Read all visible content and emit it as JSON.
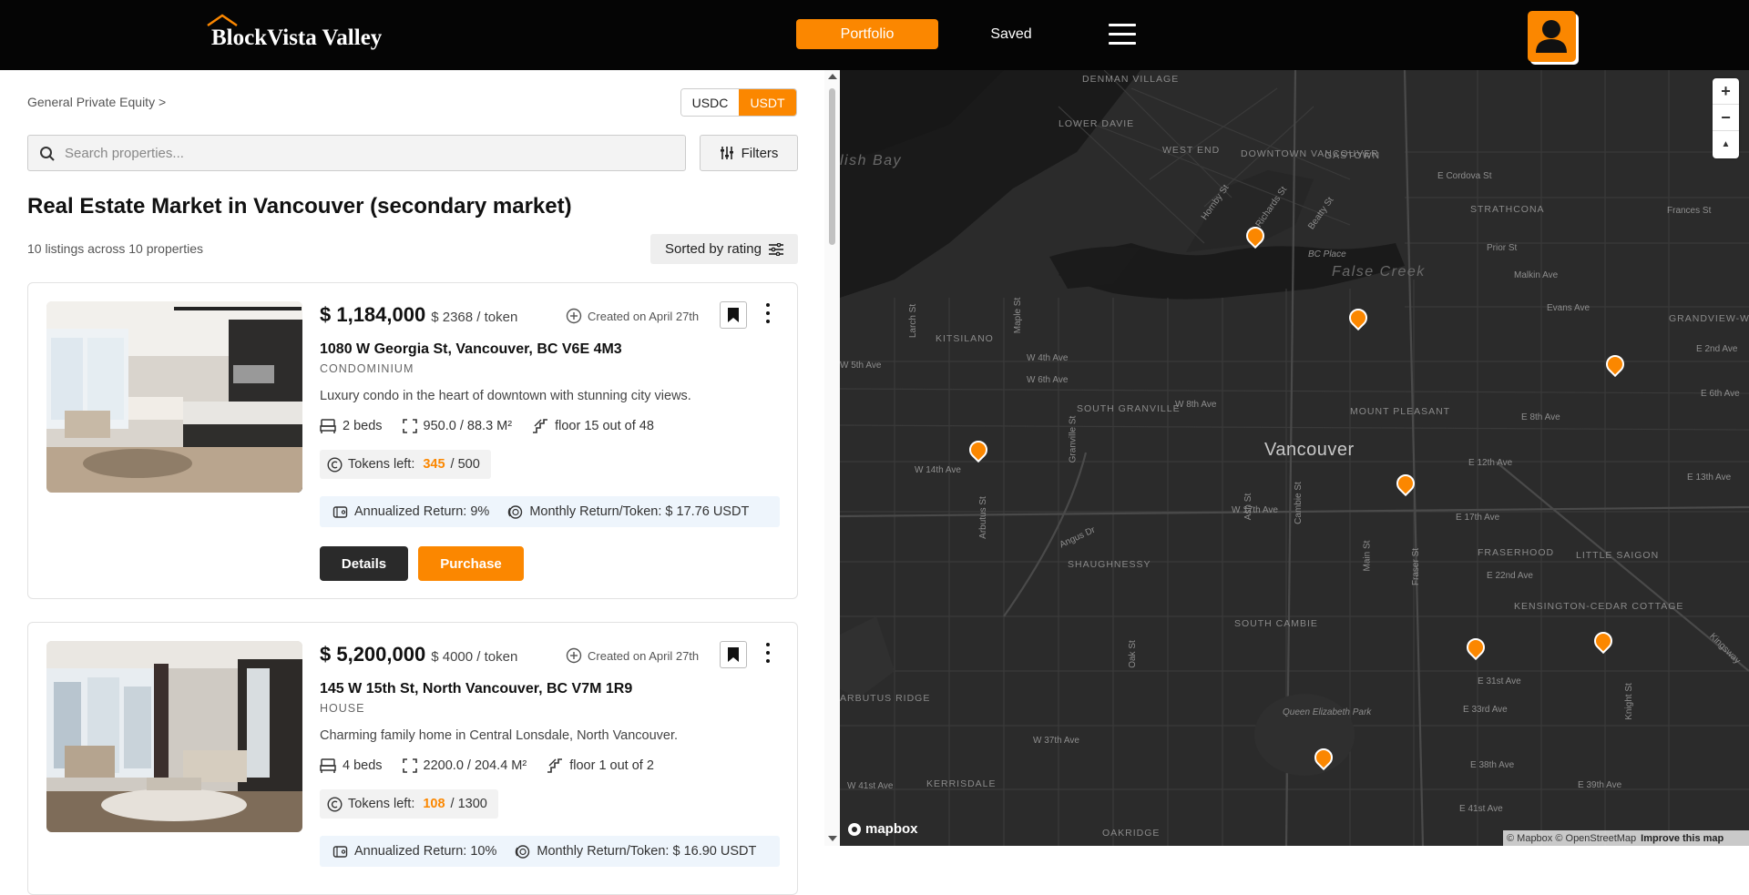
{
  "app": {
    "brand": "BlockVista Valley"
  },
  "nav": {
    "portfolio": "Portfolio",
    "saved": "Saved"
  },
  "colors": {
    "accent": "#fb8700",
    "topbar": "#050505",
    "map_bg": "#262626"
  },
  "breadcrumb": "General Private Equity >",
  "currency": {
    "options": [
      "USDC",
      "USDT"
    ],
    "selected": "USDT"
  },
  "search": {
    "placeholder": "Search properties...",
    "value": ""
  },
  "filters_label": "Filters",
  "page_title": "Real Estate Market in Vancouver (secondary market)",
  "listing_count": "10 listings across 10 properties",
  "sort_label": "Sorted by rating",
  "listings": [
    {
      "price": "$ 1,184,000",
      "per_token": "$ 2368 / token",
      "created": "Created on April 27th",
      "address": "1080 W Georgia St, Vancouver, BC V6E 4M3",
      "type": "CONDOMINIUM",
      "description": "Luxury condo in the heart of downtown with stunning city views.",
      "beds": "2 beds",
      "area": "950.0 / 88.3 M²",
      "floor": "floor 15 out of 48",
      "tokens_label": "Tokens left:",
      "tokens_left": "345",
      "tokens_total": "/ 500",
      "annualized": "Annualized Return: 9%",
      "monthly": "Monthly Return/Token: $ 17.76 USDT",
      "details": "Details",
      "purchase": "Purchase"
    },
    {
      "price": "$ 5,200,000",
      "per_token": "$ 4000 / token",
      "created": "Created on April 27th",
      "address": "145 W 15th St, North Vancouver, BC V7M 1R9",
      "type": "HOUSE",
      "description": "Charming family home in Central Lonsdale, North Vancouver.",
      "beds": "4 beds",
      "area": "2200.0 / 204.4 M²",
      "floor": "floor 1 out of 2",
      "tokens_label": "Tokens left:",
      "tokens_left": "108",
      "tokens_total": "/ 1300",
      "annualized": "Annualized Return: 10%",
      "monthly": "Monthly Return/Token: $ 16.90 USDT",
      "details": "Details",
      "purchase": "Purchase"
    }
  ],
  "map": {
    "city": "Vancouver",
    "water_labels": [
      "False Creek",
      "lish Bay"
    ],
    "areas": [
      "DENMAN VILLAGE",
      "LOWER DAVIE",
      "WEST END",
      "DOWNTOWN VANCOUVER",
      "GASTOWN",
      "STRATHCONA",
      "KITSILANO",
      "SOUTH GRANVILLE",
      "MOUNT PLEASANT",
      "GRANDVIEW-WOODLAND",
      "FRASERHOOD",
      "LITTLE SAIGON",
      "SHAUGHNESSY",
      "SOUTH CAMBIE",
      "KENSINGTON-CEDAR COTTAGE",
      "ARBUTUS RIDGE",
      "KERRISDALE",
      "OAKRIDGE"
    ],
    "streets": [
      "E Cordova St",
      "Frances St",
      "Prior St",
      "Malkin Ave",
      "Evans Ave",
      "E 2nd Ave",
      "E 6th Ave",
      "E 8th Ave",
      "E 12th Ave",
      "E 13th Ave",
      "E 17th Ave",
      "E 22nd Ave",
      "E 31st Ave",
      "E 33rd Ave",
      "E 38th Ave",
      "E 39th Ave",
      "E 41st Ave",
      "W 4th Ave",
      "W 5th Ave",
      "W 6th Ave",
      "W 8th Ave",
      "W 14th Ave",
      "W 17th Ave",
      "W 37th Ave",
      "W 41st Ave",
      "Hornby St",
      "Beatty St",
      "Richards St",
      "BC Place",
      "Larch St",
      "Maple St",
      "Arbutus St",
      "Cambie St",
      "Ash St",
      "Main St",
      "Fraser St",
      "Knight St",
      "Kingsway",
      "Queen Elizabeth Park",
      "Angus Dr",
      "Granville St",
      "Oak St"
    ],
    "zoom_in": "+",
    "zoom_out": "−",
    "compass": "▲",
    "logo": "mapbox",
    "attribution": "© Mapbox © OpenStreetMap",
    "improve": "Improve this map"
  }
}
